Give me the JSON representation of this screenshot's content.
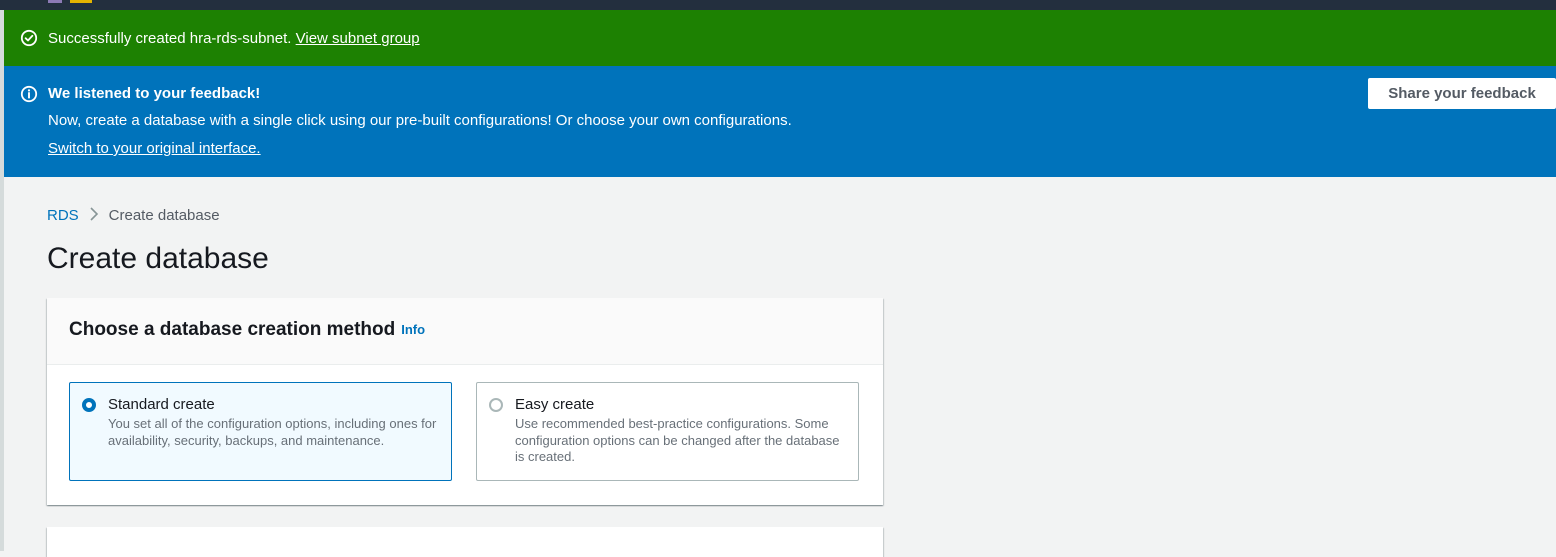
{
  "colors": {
    "success_bg": "#1d8102",
    "info_bg": "#0073bb",
    "link": "#0073bb",
    "page_bg": "#f2f3f3",
    "top_nav": "#232f3e"
  },
  "success_flash": {
    "icon": "check-circle-icon",
    "message": "Successfully created hra-rds-subnet.",
    "link_text": "View subnet group"
  },
  "info_flash": {
    "icon": "info-circle-icon",
    "title": "We listened to your feedback!",
    "body": "Now, create a database with a single click using our pre-built configurations! Or choose your own configurations.",
    "switch_link": "Switch to your original interface.",
    "feedback_button": "Share your feedback"
  },
  "breadcrumb": {
    "root": "RDS",
    "separator_icon": "chevron-right-icon",
    "current": "Create database"
  },
  "page_title": "Create database",
  "creation_method": {
    "title": "Choose a database creation method",
    "info_link": "Info",
    "options": [
      {
        "label": "Standard create",
        "description": "You set all of the configuration options, including ones for availability, security, backups, and maintenance.",
        "selected": true
      },
      {
        "label": "Easy create",
        "description": "Use recommended best-practice configurations. Some configuration options can be changed after the database is created.",
        "selected": false
      }
    ]
  }
}
